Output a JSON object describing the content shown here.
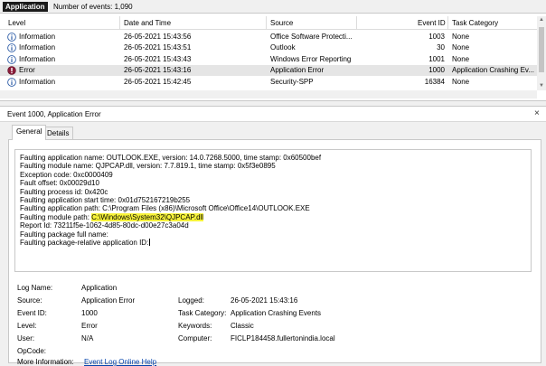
{
  "titlebar": {
    "title": "Application",
    "count": "Number of events: 1,090"
  },
  "grid": {
    "columns": [
      "Level",
      "Date and Time",
      "Source",
      "Event ID",
      "Task Category"
    ],
    "rows": [
      {
        "level": "Information",
        "icon": "info-icon",
        "date": "26-05-2021 15:43:56",
        "source": "Office Software Protecti...",
        "event_id": "1003",
        "task": "None",
        "selected": false
      },
      {
        "level": "Information",
        "icon": "info-icon",
        "date": "26-05-2021 15:43:51",
        "source": "Outlook",
        "event_id": "30",
        "task": "None",
        "selected": false
      },
      {
        "level": "Information",
        "icon": "info-icon",
        "date": "26-05-2021 15:43:43",
        "source": "Windows Error Reporting",
        "event_id": "1001",
        "task": "None",
        "selected": false
      },
      {
        "level": "Error",
        "icon": "error-icon",
        "date": "26-05-2021 15:43:16",
        "source": "Application Error",
        "event_id": "1000",
        "task": "Application Crashing Ev...",
        "selected": true
      },
      {
        "level": "Information",
        "icon": "info-icon",
        "date": "26-05-2021 15:42:45",
        "source": "Security-SPP",
        "event_id": "16384",
        "task": "None",
        "selected": false
      }
    ]
  },
  "detail": {
    "title": "Event 1000, Application Error",
    "close": "×",
    "tabs": [
      "General",
      "Details"
    ],
    "description": [
      "Faulting application name: OUTLOOK.EXE, version: 14.0.7268.5000, time stamp: 0x60500bef",
      "Faulting module name: QJPCAP.dll, version: 7.7.819.1, time stamp: 0x5f3e0895",
      "Exception code: 0xc0000409",
      "Fault offset: 0x00029d10",
      "Faulting process id: 0x420c",
      "Faulting application start time: 0x01d752167219b255",
      "Faulting application path: C:\\Program Files (x86)\\Microsoft Office\\Office14\\OUTLOOK.EXE",
      "Report Id: 73211f5e-1062-4d85-80dc-d00e27c3a04d",
      "Faulting package full name:",
      "Faulting package-relative application ID:"
    ],
    "module_path_label": "Faulting module path: ",
    "module_path_value": "C:\\Windows\\System32\\QJPCAP.dll",
    "highlight_color": "#f7f33a",
    "props": {
      "log_name_label": "Log Name:",
      "log_name": "Application",
      "source_label": "Source:",
      "source": "Application Error",
      "logged_label": "Logged:",
      "logged": "26-05-2021 15:43:16",
      "event_id_label": "Event ID:",
      "event_id": "1000",
      "task_label": "Task Category:",
      "task": "Application Crashing Events",
      "level_label": "Level:",
      "level": "Error",
      "keywords_label": "Keywords:",
      "keywords": "Classic",
      "user_label": "User:",
      "user": "N/A",
      "computer_label": "Computer:",
      "computer": "FICLP184458.fullertonindia.local",
      "opcode_label": "OpCode:",
      "more_info_label": "More Information:",
      "more_info_link": "Event Log Online Help"
    }
  }
}
